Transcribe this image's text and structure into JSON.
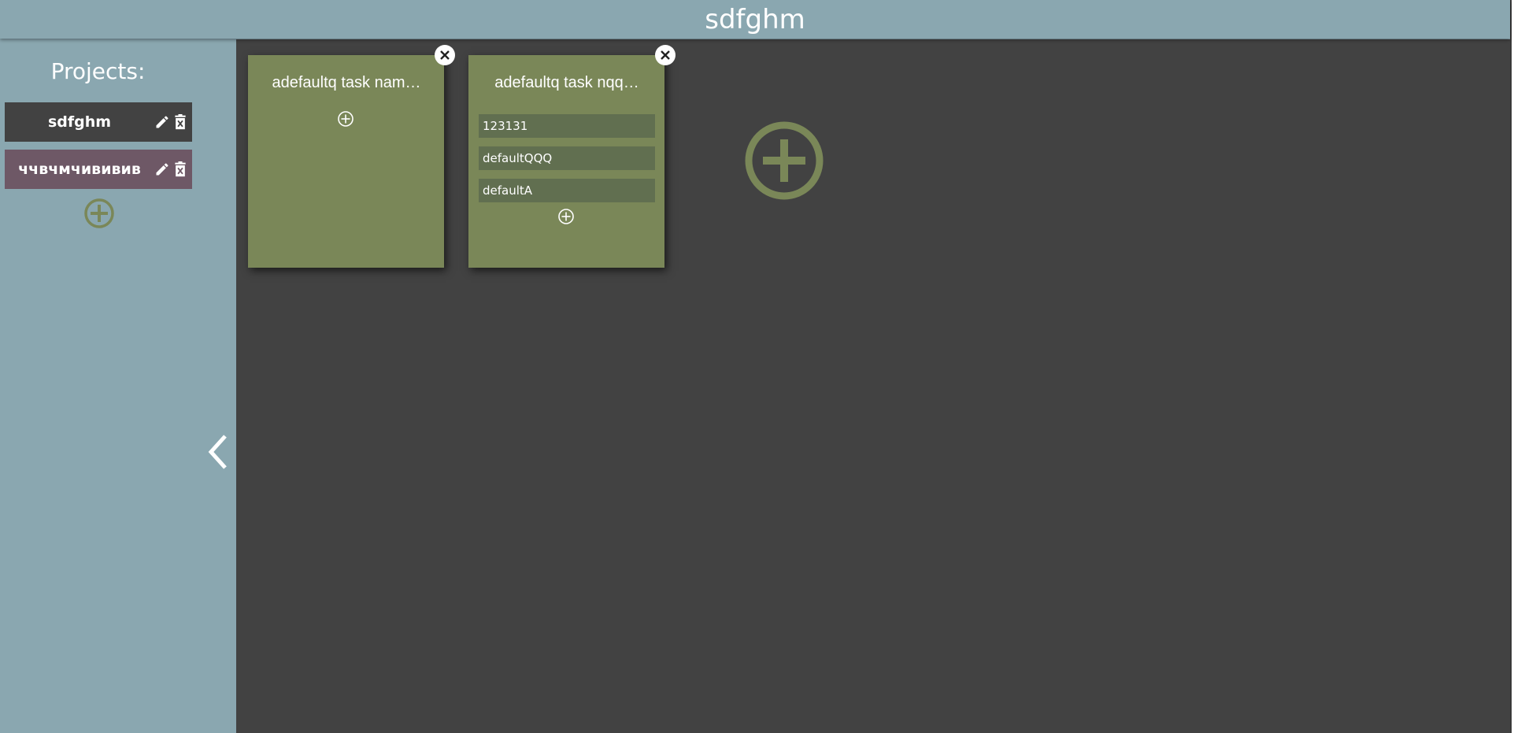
{
  "header": {
    "title": "sdfghm"
  },
  "sidebar": {
    "title": "Projects:",
    "projects": [
      {
        "name": "sdfghm"
      },
      {
        "name": "ччвчмчививив"
      }
    ]
  },
  "colors": {
    "header_bg": "#8aa7b0",
    "board_bg": "#424242",
    "card_bg": "#7a8758",
    "task_bg": "#616f50",
    "active_project_bg": "#424242",
    "project_bg": "#6e5866",
    "add_icon": "#7a8758"
  },
  "cards": [
    {
      "title": "adefaultq task nam…",
      "tasks": []
    },
    {
      "title": "adefaultq task nqq…",
      "tasks": [
        "123131",
        "defaultQQQ",
        "defaultA"
      ]
    }
  ]
}
